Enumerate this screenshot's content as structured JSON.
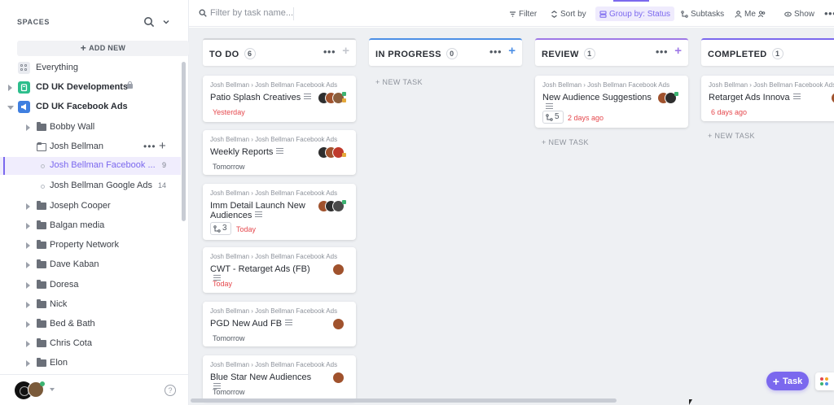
{
  "sidebar": {
    "title": "SPACES",
    "add_new": "ADD NEW",
    "everything": "Everything",
    "spaces": [
      {
        "name": "CD UK Developments",
        "color": "#2dbe8c",
        "private": true
      },
      {
        "name": "CD UK Facebook Ads",
        "color": "#3f7fe0",
        "expanded": true
      }
    ],
    "folders": [
      {
        "name": "Bobby Wall"
      },
      {
        "name": "Josh Bellman",
        "expanded": true
      },
      {
        "name": "Joseph Cooper"
      },
      {
        "name": "Balgan media"
      },
      {
        "name": "Property Network"
      },
      {
        "name": "Dave Kaban"
      },
      {
        "name": "Doresa"
      },
      {
        "name": "Nick"
      },
      {
        "name": "Bed & Bath"
      },
      {
        "name": "Chris Cota"
      },
      {
        "name": "Elon"
      }
    ],
    "lists": [
      {
        "name": "Josh Bellman Facebook ...",
        "count": "9",
        "active": true
      },
      {
        "name": "Josh Bellman Google Ads",
        "count": "14"
      }
    ]
  },
  "toolbar": {
    "filter_placeholder": "Filter by task name...",
    "filter": "Filter",
    "sort": "Sort by",
    "group": "Group by: Status",
    "subtasks": "Subtasks",
    "me": "Me",
    "show": "Show"
  },
  "columns": [
    {
      "title": "TO DO",
      "count": "6",
      "color": "#d3d5d9"
    },
    {
      "title": "IN PROGRESS",
      "count": "0",
      "color": "#4c8fe6",
      "new_task": "+ NEW TASK"
    },
    {
      "title": "REVIEW",
      "count": "1",
      "color": "#9e78e6",
      "new_task": "+ NEW TASK"
    },
    {
      "title": "COMPLETED",
      "count": "1",
      "color": "#7b68ee",
      "new_task": "+ NEW TASK"
    }
  ],
  "crumb": {
    "a": "Josh Bellman",
    "b": "Josh Bellman Facebook Ads"
  },
  "cards": {
    "todo": [
      {
        "title": "Patio Splash Creatives",
        "date": "Yesterday",
        "date_color": "red"
      },
      {
        "title": "Weekly Reports",
        "date": "Tomorrow",
        "date_color": "gray"
      },
      {
        "title": "Imm Detail Launch New Audiences",
        "subtasks": "3",
        "date": "Today",
        "date_color": "red"
      },
      {
        "title": "CWT - Retarget Ads (FB)",
        "date": "Today",
        "date_color": "red"
      },
      {
        "title": "PGD New Aud FB",
        "date": "Tomorrow",
        "date_color": "gray"
      },
      {
        "title": "Blue Star New Audiences",
        "date": "Tomorrow",
        "date_color": "gray"
      }
    ],
    "review": [
      {
        "title": "New Audience Suggestions",
        "subtasks": "5",
        "date": "2 days ago",
        "date_color": "red"
      }
    ],
    "completed": [
      {
        "title": "Retarget Ads Innova",
        "date": "6 days ago",
        "date_color": "red"
      }
    ]
  },
  "fab": {
    "label": "Task"
  },
  "colors": {
    "accent": "#7b68ee",
    "red": "#e5484d"
  }
}
